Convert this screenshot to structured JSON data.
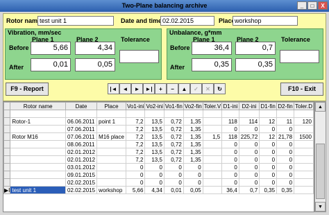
{
  "window": {
    "title": "Two-Plane balancing archive",
    "close_label": "X",
    "min_label": "_",
    "max_label": "□"
  },
  "header": {
    "rotor_label": "Rotor name",
    "rotor_value": "test unit 1",
    "date_label": "Date and time",
    "date_value": "02.02.2015",
    "place_label": "Place",
    "place_value": "workshop"
  },
  "vibration": {
    "title": "Vibration, mm/sec",
    "plane1": "Plane 1",
    "plane2": "Plane 2",
    "tolerance": "Tolerance",
    "before_label": "Before",
    "after_label": "After",
    "before_p1": "5,66",
    "before_p2": "4,34",
    "after_p1": "0,01",
    "after_p2": "0,05",
    "tolerance_value": ""
  },
  "unbalance": {
    "title": "Unbalance, g*mm",
    "plane1": "Plane 1",
    "plane2": "Plane 2",
    "tolerance": "Tolerance",
    "before_label": "Before",
    "after_label": "After",
    "before_p1": "36,4",
    "before_p2": "0,7",
    "after_p1": "0,35",
    "after_p2": "0,35",
    "tolerance_value": ""
  },
  "buttons": {
    "report": "F9 - Report",
    "exit": "F10 - Exit"
  },
  "navigator": {
    "first": "|◄",
    "prior": "◄",
    "next": "►",
    "last": "►|",
    "insert": "+",
    "delete": "−",
    "edit": "▲",
    "post": "✓",
    "cancel": "✕",
    "refresh": "↻"
  },
  "table": {
    "columns": [
      "Rotor name",
      "Date",
      "Place",
      "Vo1-ini",
      "Vo2-ini",
      "Vo1-fin",
      "Vo2-fin",
      "Toler.V",
      "D1-ini",
      "D2-ini",
      "D1-fin",
      "D2-fin",
      "Toler.D"
    ],
    "rows": [
      [
        "",
        "",
        "",
        "",
        "",
        "",
        "",
        "",
        "",
        "",
        "",
        "",
        ""
      ],
      [
        "Rotor-1",
        "06.06.2011",
        "point 1",
        "7,2",
        "13,5",
        "0,72",
        "1,35",
        "",
        "118",
        "114",
        "12",
        "11",
        "120"
      ],
      [
        "",
        "07.06.2011",
        "",
        "7,2",
        "13,5",
        "0,72",
        "1,35",
        "",
        "0",
        "0",
        "0",
        "0",
        ""
      ],
      [
        "Rotor M16",
        "07.06.2011",
        "M16 place",
        "7,2",
        "13,5",
        "0,72",
        "1,35",
        "1,5",
        "118",
        "225,72",
        "12",
        "21,78",
        "1500"
      ],
      [
        "",
        "08.06.2011",
        "",
        "7,2",
        "13,5",
        "0,72",
        "1,35",
        "",
        "0",
        "0",
        "0",
        "0",
        ""
      ],
      [
        "",
        "02.01.2012",
        "",
        "7,2",
        "13,5",
        "0,72",
        "1,35",
        "",
        "0",
        "0",
        "0",
        "0",
        ""
      ],
      [
        "",
        "02.01.2012",
        "",
        "7,2",
        "13,5",
        "0,72",
        "1,35",
        "",
        "0",
        "0",
        "0",
        "0",
        ""
      ],
      [
        "",
        "03.01.2012",
        "",
        "0",
        "0",
        "0",
        "0",
        "",
        "0",
        "0",
        "0",
        "0",
        ""
      ],
      [
        "",
        "09.01.2015",
        "",
        "0",
        "0",
        "0",
        "0",
        "",
        "0",
        "0",
        "0",
        "0",
        ""
      ],
      [
        "",
        "02.02.2015",
        "",
        "0",
        "0",
        "0",
        "0",
        "",
        "0",
        "0",
        "0",
        "0",
        ""
      ],
      [
        "test unit 1",
        "02.02.2015",
        "workshop",
        "5,66",
        "4,34",
        "0,01",
        "0,05",
        "",
        "36,4",
        "0,7",
        "0,35",
        "0,35",
        ""
      ]
    ],
    "selected_row": 10,
    "selected_marker": "▶I"
  },
  "scrollbar": {
    "up": "▲",
    "down": "▼"
  }
}
